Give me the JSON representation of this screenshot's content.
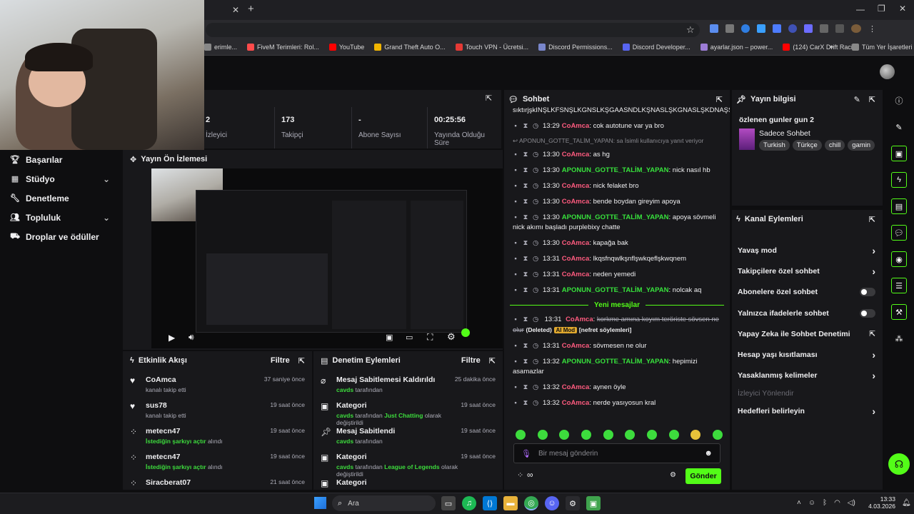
{
  "browser": {
    "new_tab_symbol": "+",
    "bookmarks": [
      {
        "label": "erimle...",
        "color": "#888888"
      },
      {
        "label": "FiveM Terimleri: Rol...",
        "color": "#ff4b4b"
      },
      {
        "label": "YouTube",
        "color": "#ff0000"
      },
      {
        "label": "Grand Theft Auto O...",
        "color": "#f0b400"
      },
      {
        "label": "Touch VPN - Ücretsi...",
        "color": "#e53935"
      },
      {
        "label": "Discord Permissions...",
        "color": "#7986cb"
      },
      {
        "label": "Discord Developer...",
        "color": "#5865f2"
      },
      {
        "label": "ayarlar.json – power...",
        "color": "#9c7cd6"
      },
      {
        "label": "(124) CarX Drift Raci...",
        "color": "#ff0000"
      }
    ],
    "more_symbol": "»",
    "all_bookmarks": "Tüm Yer İşaretleri"
  },
  "stats": [
    {
      "value": "2",
      "label": "İzleyici"
    },
    {
      "value": "173",
      "label": "Takipçi"
    },
    {
      "value": "-",
      "label": "Abone Sayısı"
    },
    {
      "value": "00:25:56",
      "label": "Yayında Olduğu Süre"
    }
  ],
  "sidebar": {
    "items": [
      {
        "label": "Başarılar",
        "icon": "trophy-icon",
        "chevron": false
      },
      {
        "label": "Stüdyo",
        "icon": "studio-icon",
        "chevron": true
      },
      {
        "label": "Denetleme",
        "icon": "wrench-icon",
        "chevron": false
      },
      {
        "label": "Topluluk",
        "icon": "community-icon",
        "chevron": true
      },
      {
        "label": "Droplar ve ödüller",
        "icon": "gift-icon",
        "chevron": false
      }
    ]
  },
  "preview": {
    "title": "Yayın Ön İzlemesi"
  },
  "activity": {
    "title": "Etkinlik Akışı",
    "filter": "Filtre",
    "items": [
      {
        "name": "CoAmca",
        "sub": "kanalı takip etti",
        "time": "37 saniye önce",
        "icon": "heart-icon"
      },
      {
        "name": "sus78",
        "sub": "kanalı takip etti",
        "time": "19 saat önce",
        "icon": "heart-icon"
      },
      {
        "name": "metecn47",
        "sub_green": "İstediğin şarkıyı açtır",
        "sub": "alındı",
        "time": "19 saat önce",
        "icon": "points-icon"
      },
      {
        "name": "metecn47",
        "sub_green": "İstediğin şarkıyı açtır",
        "sub": "alındı",
        "time": "19 saat önce",
        "icon": "points-icon"
      },
      {
        "name": "Siracberat07",
        "sub": "",
        "time": "21 saat önce",
        "icon": "points-icon"
      }
    ]
  },
  "modactions": {
    "title": "Denetim Eylemleri",
    "filter": "Filtre",
    "items": [
      {
        "title": "Mesaj Sabitlemesi Kaldırıldı",
        "actor": "cavds",
        "rest": "tarafından",
        "extra": "",
        "extra2": "",
        "time": "25 dakika önce",
        "icon": "unpin-icon"
      },
      {
        "title": "Kategori",
        "actor": "cavds",
        "rest": "tarafından",
        "extra": "Just Chatting",
        "extra2": "olarak değiştirildi",
        "time": "19 saat önce",
        "icon": "category-icon"
      },
      {
        "title": "Mesaj Sabitlendi",
        "actor": "cavds",
        "rest": "tarafından",
        "extra": "",
        "extra2": "",
        "time": "19 saat önce",
        "icon": "pin-icon"
      },
      {
        "title": "Kategori",
        "actor": "cavds",
        "rest": "tarafından",
        "extra": "League of Legends",
        "extra2": "olarak değiştirildi",
        "time": "19 saat önce",
        "icon": "category-icon"
      },
      {
        "title": "Kategori",
        "actor": "",
        "rest": "",
        "extra": "",
        "extra2": "",
        "time": "",
        "icon": "category-icon"
      }
    ]
  },
  "chat": {
    "title": "Sohbet",
    "top_text": "sıktırjşkINŞLKFSNŞLKGNSLKŞGAASNDLKŞNASLŞKGNASLŞKDNAŞSLKDN",
    "reply_note": "↩ APONUN_GOTTE_TALİM_YAPAN: sa İsimli kullanıcıya yanıt veriyor",
    "messages": [
      {
        "time": "13:29",
        "user": "CoAmca",
        "color": "red",
        "text": "cok autotune var ya bro"
      },
      {
        "time": "13:30",
        "user": "CoAmca",
        "color": "red",
        "text": "as hg"
      },
      {
        "time": "13:30",
        "user": "APONUN_GOTTE_TALİM_YAPAN",
        "color": "green",
        "text": "nick nasıl hb"
      },
      {
        "time": "13:30",
        "user": "CoAmca",
        "color": "red",
        "text": "nick felaket bro"
      },
      {
        "time": "13:30",
        "user": "CoAmca",
        "color": "red",
        "text": "bende boydan gireyim apoya"
      },
      {
        "time": "13:30",
        "user": "APONUN_GOTTE_TALİM_YAPAN",
        "color": "green",
        "text": "apoya sövmeli nick akımı başladı purplebixy chatte"
      },
      {
        "time": "13:30",
        "user": "CoAmca",
        "color": "red",
        "text": "kapağa bak"
      },
      {
        "time": "13:31",
        "user": "CoAmca",
        "color": "red",
        "text": "lkqsfnqwlkşnflşwkqeflşkwqnem"
      },
      {
        "time": "13:31",
        "user": "CoAmca",
        "color": "red",
        "text": "neden yemedi"
      },
      {
        "time": "13:31",
        "user": "APONUN_GOTTE_TALİM_YAPAN",
        "color": "green",
        "text": "nolcak aq"
      }
    ],
    "new_messages": "Yeni mesajlar",
    "deleted": {
      "time": "13:31",
      "user": "CoAmca",
      "text": "korkme amına koyım teröriste sövsen ne olur",
      "deleted_label": "(Deleted)",
      "ai_label": "AI Mod",
      "reason": "[nefret söylemleri]"
    },
    "messages2": [
      {
        "time": "13:31",
        "user": "CoAmca",
        "color": "red",
        "text": "sövmesen ne olur"
      },
      {
        "time": "13:32",
        "user": "APONUN_GOTTE_TALİM_YAPAN",
        "color": "green",
        "text": "hepimizi asamazlar"
      },
      {
        "time": "13:32",
        "user": "CoAmca",
        "color": "red",
        "text": "aynen öyle"
      },
      {
        "time": "13:32",
        "user": "CoAmca",
        "color": "red",
        "text": "nerde yasıyosun kral"
      }
    ],
    "input_placeholder": "Bir mesaj gönderin",
    "points": "∞",
    "send": "Gönder"
  },
  "streaminfo": {
    "title": "Yayın bilgisi",
    "stream_title": "özlenen gunler gun 2",
    "category": "Sadece Sohbet",
    "tags": [
      "Turkish",
      "Türkçe",
      "chill",
      "gamin"
    ]
  },
  "channelactions": {
    "title": "Kanal Eylemleri",
    "rows": [
      {
        "label": "Yavaş mod",
        "kind": "chev"
      },
      {
        "label": "Takipçilere özel sohbet",
        "kind": "chev"
      },
      {
        "label": "Abonelere özel sohbet",
        "kind": "toggle"
      },
      {
        "label": "Yalnızca ifadelerle sohbet",
        "kind": "toggle"
      },
      {
        "label": "Yapay Zeka ile Sohbet Denetimi",
        "kind": "ext"
      },
      {
        "label": "Hesap yaşı kısıtlaması",
        "kind": "chev"
      },
      {
        "label": "Yasaklanmış kelimeler",
        "kind": "chev"
      },
      {
        "label": "İzleyici Yönlendir",
        "kind": "none"
      },
      {
        "label": "Hedefleri belirleyin",
        "kind": "chev"
      }
    ]
  },
  "taskbar": {
    "search": "Ara",
    "time": "13:33",
    "date": "4.03.2026"
  },
  "colors": {
    "accent": "#53fc18",
    "panel": "#18181b",
    "bg": "#0e0e10"
  }
}
